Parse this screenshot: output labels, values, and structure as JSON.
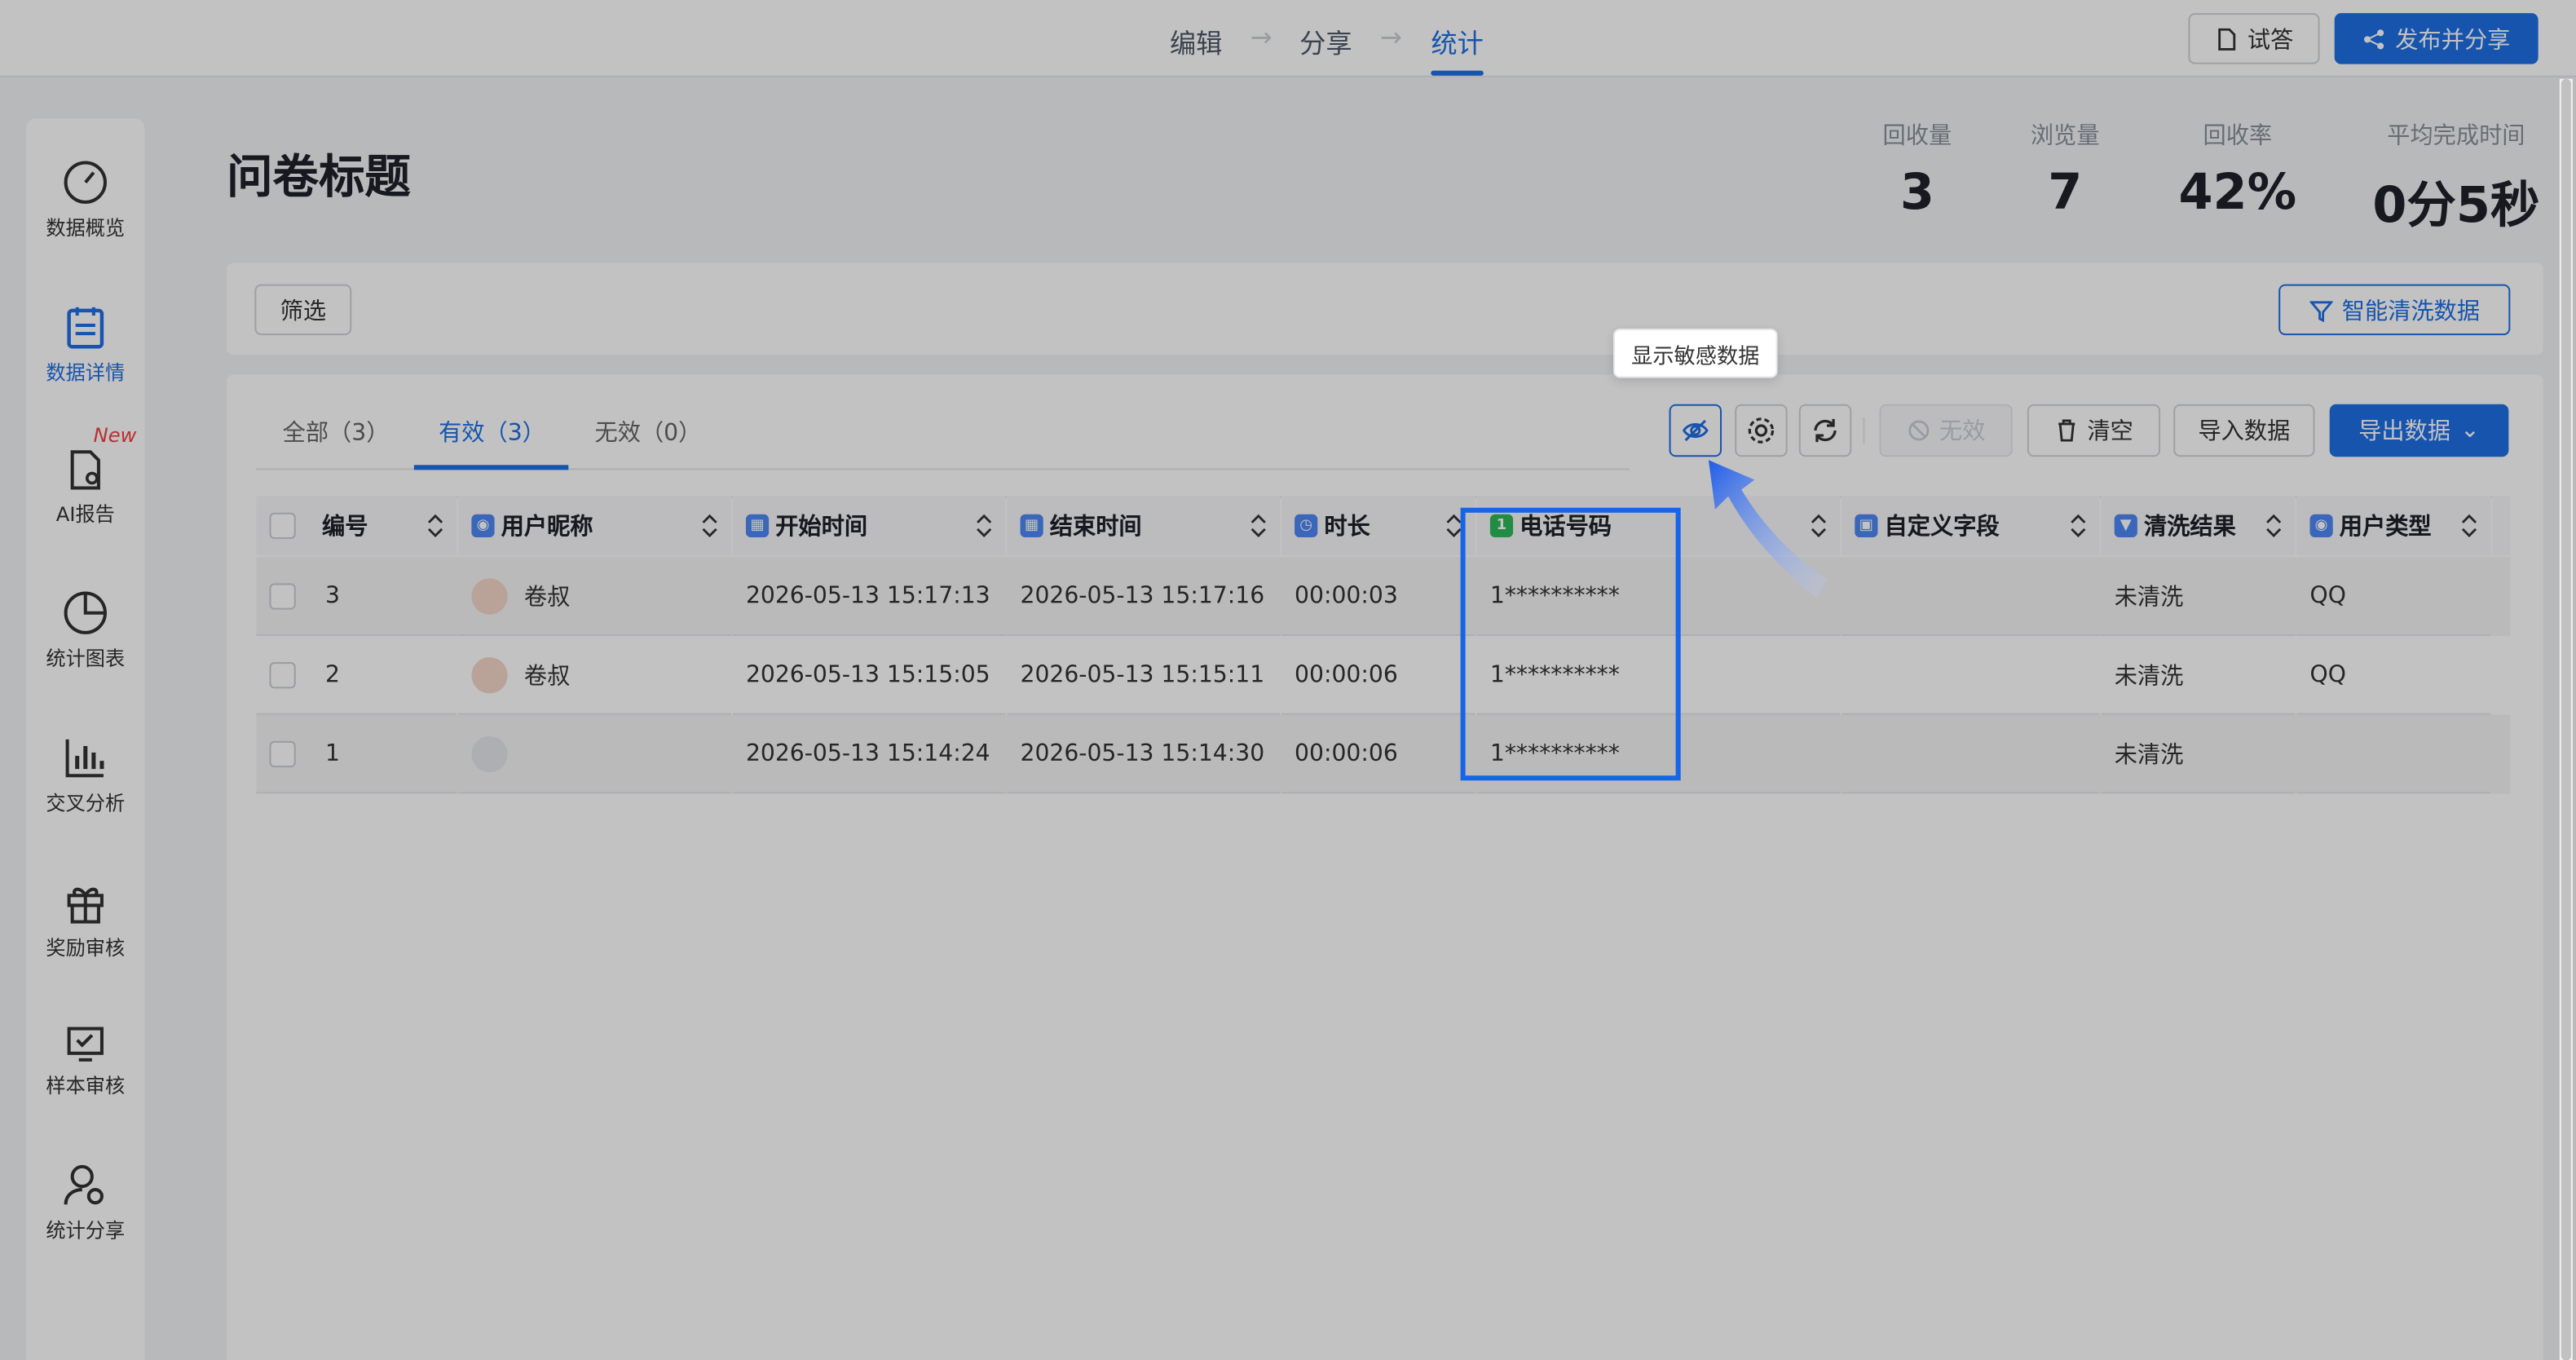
{
  "steps": [
    "编辑",
    "分享",
    "统计"
  ],
  "topbar": {
    "try_label": "试答",
    "publish_label": "发布并分享"
  },
  "sidebar": [
    {
      "label": "数据概览",
      "icon": "gauge-icon"
    },
    {
      "label": "数据详情",
      "icon": "clipboard-icon"
    },
    {
      "label": "AI报告",
      "icon": "ai-report-icon",
      "badge": "New"
    },
    {
      "label": "统计图表",
      "icon": "pie-chart-icon"
    },
    {
      "label": "交叉分析",
      "icon": "bar-chart-icon"
    },
    {
      "label": "奖励审核",
      "icon": "gift-icon"
    },
    {
      "label": "样本审核",
      "icon": "check-board-icon"
    },
    {
      "label": "统计分享",
      "icon": "user-share-icon"
    }
  ],
  "page": {
    "title": "问卷标题"
  },
  "stats": [
    {
      "label": "回收量",
      "value": "3"
    },
    {
      "label": "浏览量",
      "value": "7"
    },
    {
      "label": "回收率",
      "value": "42%"
    },
    {
      "label": "平均完成时间",
      "value": "0分5秒"
    }
  ],
  "filter": {
    "button": "筛选",
    "smart_clean": "智能清洗数据"
  },
  "tabs": [
    "全部（3）",
    "有效（3）",
    "无效（0）"
  ],
  "toolbar": {
    "tooltip": "显示敏感数据",
    "invalid": "无效",
    "clear": "清空",
    "import": "导入数据",
    "export": "导出数据"
  },
  "table": {
    "headers": [
      "编号",
      "用户昵称",
      "开始时间",
      "结束时间",
      "时长",
      "电话号码",
      "自定义字段",
      "清洗结果",
      "用户类型"
    ],
    "rows": [
      {
        "id": "3",
        "nick": "卷叔",
        "start": "2026-05-13 15:17:13",
        "end": "2026-05-13 15:17:16",
        "dur": "00:00:03",
        "phone": "1**********",
        "custom": "",
        "clean": "未清洗",
        "type": "QQ"
      },
      {
        "id": "2",
        "nick": "卷叔",
        "start": "2026-05-13 15:15:05",
        "end": "2026-05-13 15:15:11",
        "dur": "00:00:06",
        "phone": "1**********",
        "custom": "",
        "clean": "未清洗",
        "type": "QQ"
      },
      {
        "id": "1",
        "nick": "",
        "start": "2026-05-13 15:14:24",
        "end": "2026-05-13 15:14:30",
        "dur": "00:00:06",
        "phone": "1**********",
        "custom": "",
        "clean": "未清洗",
        "type": ""
      }
    ]
  },
  "colors": {
    "accent": "#1f6fe5",
    "highlight_box": "#1565e8",
    "badge_red": "#f53f3f",
    "phone_icon": "#2fb85a"
  }
}
